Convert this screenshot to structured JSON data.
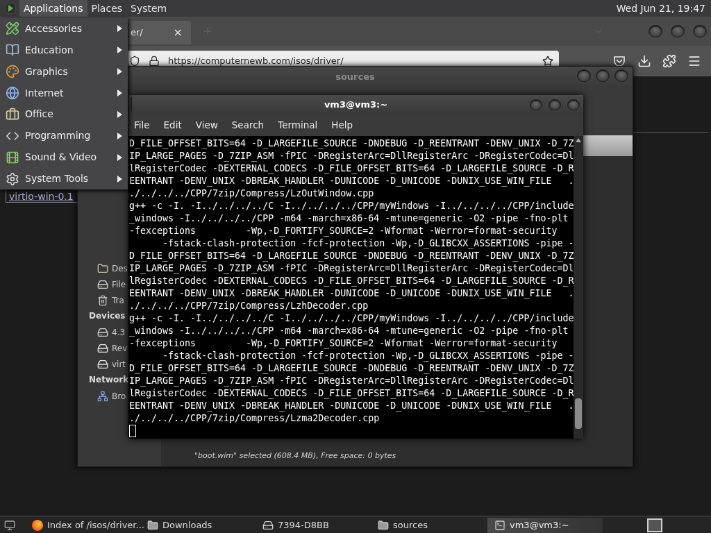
{
  "top_panel": {
    "menus": [
      {
        "label": "Applications",
        "selected": true
      },
      {
        "label": "Places",
        "selected": false
      },
      {
        "label": "System",
        "selected": false
      }
    ],
    "clock": "Wed Jun 21, 19:47"
  },
  "applications_menu": [
    {
      "label": "Accessories"
    },
    {
      "label": "Education"
    },
    {
      "label": "Graphics"
    },
    {
      "label": "Internet"
    },
    {
      "label": "Office"
    },
    {
      "label": "Programming"
    },
    {
      "label": "Sound & Video"
    },
    {
      "label": "System Tools"
    }
  ],
  "browser": {
    "tab_title": "er/",
    "tab_close": "×",
    "url": "https://computernewb.com/isos/driver/",
    "page_link": "virtio-win-0.1"
  },
  "file_manager": {
    "title": "sources",
    "sidebar": [
      {
        "kind": "folder",
        "label": "Des"
      },
      {
        "kind": "drive",
        "label": "File"
      },
      {
        "kind": "trash",
        "label": "Tra"
      },
      {
        "kind": "heading",
        "label": "Devices"
      },
      {
        "kind": "drive",
        "label": "4.3"
      },
      {
        "kind": "removable",
        "label": "Rev"
      },
      {
        "kind": "removable",
        "label": "virt"
      },
      {
        "kind": "heading",
        "label": "Network"
      },
      {
        "kind": "network",
        "label": "Bro"
      }
    ],
    "status": "\"boot.wim\" selected (608.4 MB), Free space: 0 bytes"
  },
  "terminal": {
    "title": "vm3@vm3:~",
    "menu": [
      "File",
      "Edit",
      "View",
      "Search",
      "Terminal",
      "Help"
    ],
    "lines": [
      "D_FILE_OFFSET_BITS=64 -D_LARGEFILE_SOURCE -DNDEBUG -D_REENTRANT -DENV_UNIX -D_7Z",
      "IP_LARGE_PAGES -D_7ZIP_ASM -fPIC -DRegisterArc=DllRegisterArc -DRegisterCodec=Dl",
      "lRegisterCodec -DEXTERNAL_CODECS -D_FILE_OFFSET_BITS=64 -D_LARGEFILE_SOURCE -D_R",
      "EENTRANT -DENV_UNIX -DBREAK_HANDLER -DUNICODE -D_UNICODE -DUNIX_USE_WIN_FILE   .",
      "./../../../CPP/7zip/Compress/LzOutWindow.cpp",
      "g++ -c -I. -I../../../../C -I../../../../CPP/myWindows -I../../../../CPP/include",
      "_windows -I../../../../CPP -m64 -march=x86-64 -mtune=generic -O2 -pipe -fno-plt",
      "-fexceptions         -Wp,-D_FORTIFY_SOURCE=2 -Wformat -Werror=format-security",
      "      -fstack-clash-protection -fcf-protection -Wp,-D_GLIBCXX_ASSERTIONS -pipe -",
      "D_FILE_OFFSET_BITS=64 -D_LARGEFILE_SOURCE -DNDEBUG -D_REENTRANT -DENV_UNIX -D_7Z",
      "IP_LARGE_PAGES -D_7ZIP_ASM -fPIC -DRegisterArc=DllRegisterArc -DRegisterCodec=Dl",
      "lRegisterCodec -DEXTERNAL_CODECS -D_FILE_OFFSET_BITS=64 -D_LARGEFILE_SOURCE -D_R",
      "EENTRANT -DENV_UNIX -DBREAK_HANDLER -DUNICODE -D_UNICODE -DUNIX_USE_WIN_FILE   .",
      "./../../../CPP/7zip/Compress/LzhDecoder.cpp",
      "g++ -c -I. -I../../../../C -I../../../../CPP/myWindows -I../../../../CPP/include",
      "_windows -I../../../../CPP -m64 -march=x86-64 -mtune=generic -O2 -pipe -fno-plt",
      "-fexceptions         -Wp,-D_FORTIFY_SOURCE=2 -Wformat -Werror=format-security",
      "      -fstack-clash-protection -fcf-protection -Wp,-D_GLIBCXX_ASSERTIONS -pipe -",
      "D_FILE_OFFSET_BITS=64 -D_LARGEFILE_SOURCE -DNDEBUG -D_REENTRANT -DENV_UNIX -D_7Z",
      "IP_LARGE_PAGES -D_7ZIP_ASM -fPIC -DRegisterArc=DllRegisterArc -DRegisterCodec=Dl",
      "lRegisterCodec -DEXTERNAL_CODECS -D_FILE_OFFSET_BITS=64 -D_LARGEFILE_SOURCE -D_R",
      "EENTRANT -DENV_UNIX -DBREAK_HANDLER -DUNICODE -D_UNICODE -DUNIX_USE_WIN_FILE   .",
      "./../../../CPP/7zip/Compress/Lzma2Decoder.cpp"
    ]
  },
  "taskbar": [
    {
      "kind": "browser",
      "label": "Index of /isos/driver...",
      "selected": false
    },
    {
      "kind": "folder",
      "label": "Downloads",
      "selected": false
    },
    {
      "kind": "drive",
      "label": "7394-D8BB",
      "selected": false
    },
    {
      "kind": "folder",
      "label": "sources",
      "selected": false
    },
    {
      "kind": "terminal",
      "label": "vm3@vm3:~",
      "selected": true
    }
  ]
}
